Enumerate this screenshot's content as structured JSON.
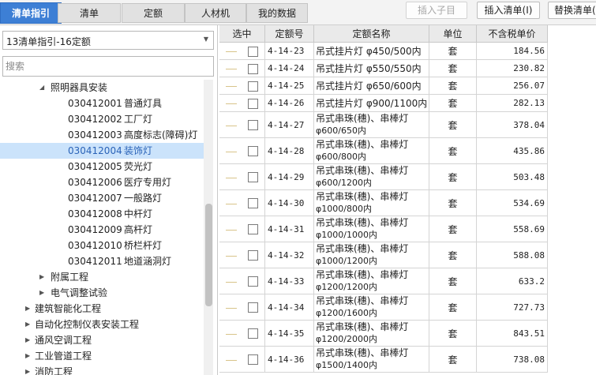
{
  "tabs": [
    {
      "label": "清单指引",
      "active": true
    },
    {
      "label": "清单",
      "active": false
    },
    {
      "label": "定额",
      "active": false
    },
    {
      "label": "人材机",
      "active": false
    },
    {
      "label": "我的数据",
      "active": false
    }
  ],
  "toolbar": {
    "insert_child": "插入子目",
    "insert_list": "插入清单(I)",
    "replace_list": "替换清单(R)"
  },
  "left_panel": {
    "library_select": "13清单指引-16定额",
    "search_placeholder": "搜索",
    "tree": [
      {
        "level": 2,
        "twisty": "expanded",
        "code": "",
        "name": "照明器具安装",
        "selected": false
      },
      {
        "level": 3,
        "twisty": "",
        "code": "030412001",
        "name": "普通灯具",
        "selected": false
      },
      {
        "level": 3,
        "twisty": "",
        "code": "030412002",
        "name": "工厂灯",
        "selected": false
      },
      {
        "level": 3,
        "twisty": "",
        "code": "030412003",
        "name": "高度标志(障碍)灯",
        "selected": false
      },
      {
        "level": 3,
        "twisty": "",
        "code": "030412004",
        "name": "装饰灯",
        "selected": true
      },
      {
        "level": 3,
        "twisty": "",
        "code": "030412005",
        "name": "荧光灯",
        "selected": false
      },
      {
        "level": 3,
        "twisty": "",
        "code": "030412006",
        "name": "医疗专用灯",
        "selected": false
      },
      {
        "level": 3,
        "twisty": "",
        "code": "030412007",
        "name": "一般路灯",
        "selected": false
      },
      {
        "level": 3,
        "twisty": "",
        "code": "030412008",
        "name": "中杆灯",
        "selected": false
      },
      {
        "level": 3,
        "twisty": "",
        "code": "030412009",
        "name": "高杆灯",
        "selected": false
      },
      {
        "level": 3,
        "twisty": "",
        "code": "030412010",
        "name": "桥栏杆灯",
        "selected": false
      },
      {
        "level": 3,
        "twisty": "",
        "code": "030412011",
        "name": "地道涵洞灯",
        "selected": false
      },
      {
        "level": 2,
        "twisty": "collapsed",
        "code": "",
        "name": "附属工程",
        "selected": false
      },
      {
        "level": 2,
        "twisty": "collapsed",
        "code": "",
        "name": "电气调整试验",
        "selected": false
      },
      {
        "level": 1,
        "twisty": "collapsed",
        "code": "",
        "name": "建筑智能化工程",
        "selected": false
      },
      {
        "level": 1,
        "twisty": "collapsed",
        "code": "",
        "name": "自动化控制仪表安装工程",
        "selected": false
      },
      {
        "level": 1,
        "twisty": "collapsed",
        "code": "",
        "name": "通风空调工程",
        "selected": false
      },
      {
        "level": 1,
        "twisty": "collapsed",
        "code": "",
        "name": "工业管道工程",
        "selected": false
      },
      {
        "level": 1,
        "twisty": "collapsed",
        "code": "",
        "name": "消防工程",
        "selected": false
      }
    ]
  },
  "grid": {
    "headers": [
      "选中",
      "定额号",
      "定额名称",
      "单位",
      "不含税单价"
    ],
    "rows": [
      {
        "code": "4-14-23",
        "name1": "吊式挂片灯 φ450/500内",
        "name2": "",
        "unit": "套",
        "price": "184.56"
      },
      {
        "code": "4-14-24",
        "name1": "吊式挂片灯 φ550/550内",
        "name2": "",
        "unit": "套",
        "price": "230.82"
      },
      {
        "code": "4-14-25",
        "name1": "吊式挂片灯 φ650/600内",
        "name2": "",
        "unit": "套",
        "price": "256.07"
      },
      {
        "code": "4-14-26",
        "name1": "吊式挂片灯 φ900/1100内",
        "name2": "",
        "unit": "套",
        "price": "282.13"
      },
      {
        "code": "4-14-27",
        "name1": "吊式串珠(穗)、串棒灯",
        "name2": "φ600/650内",
        "unit": "套",
        "price": "378.04"
      },
      {
        "code": "4-14-28",
        "name1": "吊式串珠(穗)、串棒灯",
        "name2": "φ600/800内",
        "unit": "套",
        "price": "435.86"
      },
      {
        "code": "4-14-29",
        "name1": "吊式串珠(穗)、串棒灯",
        "name2": "φ600/1200内",
        "unit": "套",
        "price": "503.48"
      },
      {
        "code": "4-14-30",
        "name1": "吊式串珠(穗)、串棒灯",
        "name2": "φ1000/800内",
        "unit": "套",
        "price": "534.69"
      },
      {
        "code": "4-14-31",
        "name1": "吊式串珠(穗)、串棒灯",
        "name2": "φ1000/1000内",
        "unit": "套",
        "price": "558.69"
      },
      {
        "code": "4-14-32",
        "name1": "吊式串珠(穗)、串棒灯",
        "name2": "φ1000/1200内",
        "unit": "套",
        "price": "588.08"
      },
      {
        "code": "4-14-33",
        "name1": "吊式串珠(穗)、串棒灯",
        "name2": "φ1200/1200内",
        "unit": "套",
        "price": "633.2"
      },
      {
        "code": "4-14-34",
        "name1": "吊式串珠(穗)、串棒灯",
        "name2": "φ1200/1600内",
        "unit": "套",
        "price": "727.73"
      },
      {
        "code": "4-14-35",
        "name1": "吊式串珠(穗)、串棒灯",
        "name2": "φ1200/2000内",
        "unit": "套",
        "price": "843.51"
      },
      {
        "code": "4-14-36",
        "name1": "吊式串珠(穗)、串棒灯",
        "name2": "φ1500/1400内",
        "unit": "套",
        "price": "738.08"
      }
    ]
  }
}
